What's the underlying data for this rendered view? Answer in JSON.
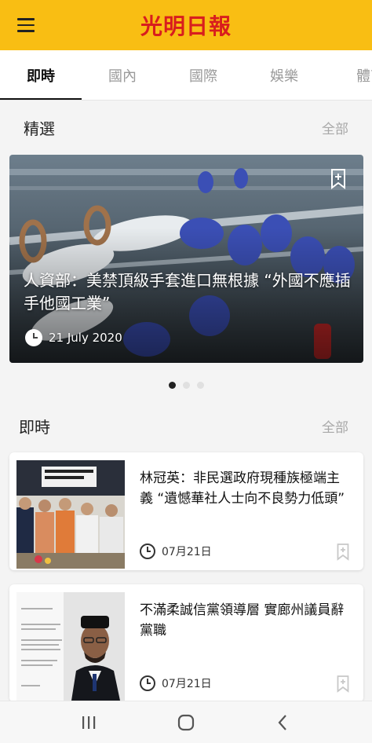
{
  "header": {
    "logo_text": "光明日報",
    "menu_icon": "hamburger-menu-icon"
  },
  "tabs": [
    {
      "label": "即時",
      "active": true
    },
    {
      "label": "國內",
      "active": false
    },
    {
      "label": "國際",
      "active": false
    },
    {
      "label": "娛樂",
      "active": false
    },
    {
      "label": "體育",
      "active": false
    }
  ],
  "featured_section": {
    "title": "精選",
    "see_all": "全部",
    "card": {
      "title": "人資部：美禁頂級手套進口無根據 “外國不應插手他國工業”",
      "date": "21 July 2020",
      "bookmark_icon": "bookmark-icon"
    },
    "carousel": {
      "count": 3,
      "active_index": 0
    }
  },
  "latest_section": {
    "title": "即時",
    "see_all": "全部",
    "items": [
      {
        "title": "林冠英：非民選政府現種族極端主義 “遺憾華社人士向不良勢力低頭”",
        "date": "07月21日"
      },
      {
        "title": "不滿柔誠信黨領導層 實廊州議員辭黨職",
        "date": "07月21日"
      }
    ]
  },
  "system_nav": {
    "recents_icon": "recents-icon",
    "home_icon": "home-icon",
    "back_icon": "back-icon"
  },
  "colors": {
    "header_bg": "#f9be13",
    "logo": "#d81e1e",
    "background": "#f4f4f4"
  }
}
